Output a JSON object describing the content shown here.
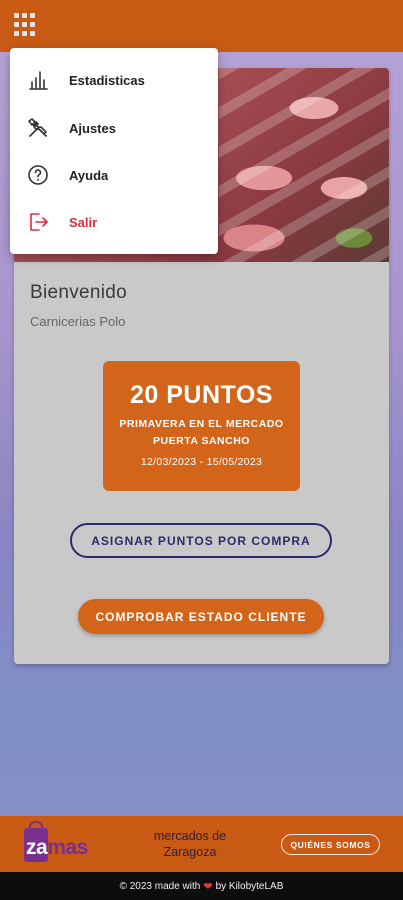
{
  "header": {
    "menu_icon": "grid-apps-icon"
  },
  "menu": {
    "items": [
      {
        "label": "Estadisticas",
        "icon": "bar-chart-icon"
      },
      {
        "label": "Ajustes",
        "icon": "tools-icon"
      },
      {
        "label": "Ayuda",
        "icon": "help-circle-icon"
      },
      {
        "label": "Salir",
        "icon": "logout-icon"
      }
    ]
  },
  "card": {
    "image": "meat-counter-photo",
    "welcome": "Bienvenido",
    "shop_name": "Carnicerias Polo",
    "points": {
      "value": "20 PUNTOS",
      "promo_line1": "PRIMAVERA EN EL MERCADO",
      "promo_line2": "PUERTA SANCHO",
      "dates": "12/03/2023 - 15/05/2023"
    },
    "assign_button": "ASIGNAR PUNTOS POR COMPRA",
    "check_button": "COMPROBAR ESTADO CLIENTE"
  },
  "footer": {
    "logo_text_za": "za",
    "logo_text_mas": "mas",
    "tagline_line1": "mercados de",
    "tagline_line2": "Zaragoza",
    "who_button": "QUIÉNES SOMOS"
  },
  "bottom_bar": {
    "prefix": "© 2023 made with",
    "suffix": "by KilobyteLAB"
  },
  "colors": {
    "brand_orange": "#c85a14",
    "button_orange": "#d3651a",
    "outline_navy": "#2c2a6a",
    "danger_red": "#e02a3e",
    "logo_purple": "#7a2f8f"
  }
}
